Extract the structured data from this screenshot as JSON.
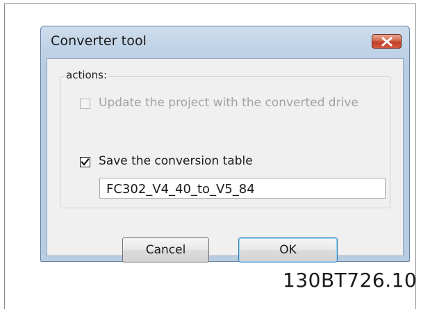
{
  "dialog": {
    "title": "Converter tool",
    "close_icon": "close-icon",
    "group_label": "actions:",
    "update_project_checkbox": {
      "label": "Update the project with the converted drive",
      "checked": false,
      "enabled": false
    },
    "save_table_checkbox": {
      "label": "Save the conversion table",
      "checked": true,
      "enabled": true
    },
    "table_name_value": "FC302_V4_40_to_V5_84",
    "cancel_label": "Cancel",
    "ok_label": "OK"
  },
  "figure_id": "130BT726.10",
  "colors": {
    "title_bar": "#bfd2e6",
    "close_button": "#c0402a",
    "client_area": "#f0f0f0",
    "disabled_text": "#a3a3a3"
  }
}
